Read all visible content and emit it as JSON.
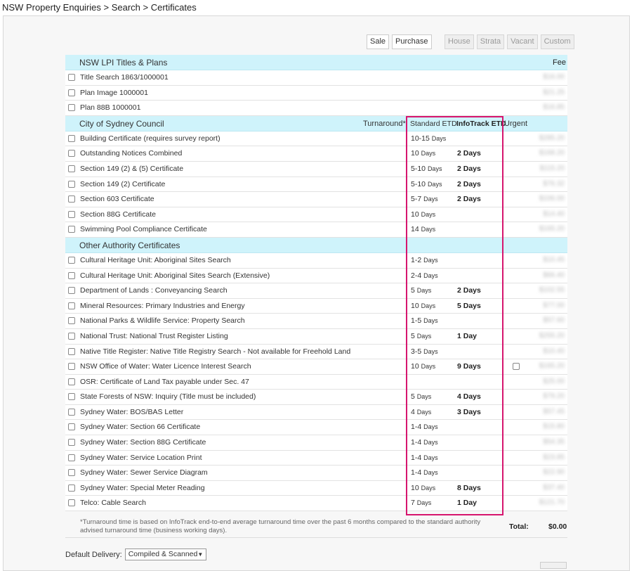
{
  "breadcrumb": "NSW Property Enquiries > Search > Certificates",
  "filters": {
    "group1": [
      "Sale",
      "Purchase"
    ],
    "group2": [
      "House",
      "Strata",
      "Vacant",
      "Custom"
    ]
  },
  "sections": [
    {
      "title": "NSW LPI Titles & Plans",
      "fee_label": "Fee",
      "rows": [
        {
          "name": "Title Search 1863/1000001",
          "std": "",
          "std_unit": "",
          "ifx": "",
          "fee": "$16.00"
        },
        {
          "name": "Plan Image 1000001",
          "std": "",
          "std_unit": "",
          "ifx": "",
          "fee": "$21.25"
        },
        {
          "name": "Plan 88B 1000001",
          "std": "",
          "std_unit": "",
          "ifx": "",
          "fee": "$16.85"
        }
      ]
    },
    {
      "title": "City of Sydney Council",
      "turnaround_label": "Turnaround*",
      "std_label": "Standard ETD",
      "ifx_label": "InfoTrack ETD",
      "urgent_label": "Urgent",
      "rows": [
        {
          "name": "Building Certificate (requires survey report)",
          "std": "10-15",
          "std_unit": "Days",
          "ifx": "",
          "fee": "$285.20"
        },
        {
          "name": "Outstanding Notices Combined",
          "std": "10",
          "std_unit": "Days",
          "ifx": "2 Days",
          "fee": "$168.20"
        },
        {
          "name": "Section 149 (2) & (5) Certificate",
          "std": "5-10",
          "std_unit": "Days",
          "ifx": "2 Days",
          "fee": "$115.20"
        },
        {
          "name": "Section 149 (2) Certificate",
          "std": "5-10",
          "std_unit": "Days",
          "ifx": "2 Days",
          "fee": "$76.32"
        },
        {
          "name": "Section 603 Certificate",
          "std": "5-7",
          "std_unit": "Days",
          "ifx": "2 Days",
          "fee": "$106.00"
        },
        {
          "name": "Section 88G Certificate",
          "std": "10",
          "std_unit": "Days",
          "ifx": "",
          "fee": "$14.40"
        },
        {
          "name": "Swimming Pool Compliance Certificate",
          "std": "14",
          "std_unit": "Days",
          "ifx": "",
          "fee": "$165.20"
        }
      ]
    },
    {
      "title": "Other Authority Certificates",
      "rows": [
        {
          "name": "Cultural Heritage Unit: Aboriginal Sites Search",
          "std": "1-2",
          "std_unit": "Days",
          "ifx": "",
          "fee": "$10.45"
        },
        {
          "name": "Cultural Heritage Unit: Aboriginal Sites Search (Extensive)",
          "std": "2-4",
          "std_unit": "Days",
          "ifx": "",
          "fee": "$66.40"
        },
        {
          "name": "Department of Lands : Conveyancing Search",
          "std": "5",
          "std_unit": "Days",
          "ifx": "2 Days",
          "fee": "$102.55"
        },
        {
          "name": "Mineral Resources: Primary Industries and Energy",
          "std": "10",
          "std_unit": "Days",
          "ifx": "5 Days",
          "fee": "$77.00"
        },
        {
          "name": "National Parks & Wildlife Service: Property Search",
          "std": "1-5",
          "std_unit": "Days",
          "ifx": "",
          "fee": "$57.60"
        },
        {
          "name": "National Trust: National Trust Register Listing",
          "std": "5",
          "std_unit": "Days",
          "ifx": "1 Day",
          "fee": "$255.20"
        },
        {
          "name": "Native Title Register: Native Title Registry Search - Not available for Freehold Land",
          "std": "3-5",
          "std_unit": "Days",
          "ifx": "",
          "fee": "$10.40"
        },
        {
          "name": "NSW Office of Water: Water Licence Interest Search",
          "std": "10",
          "std_unit": "Days",
          "ifx": "9 Days",
          "fee": "$165.20",
          "urgent": true
        },
        {
          "name": "OSR: Certificate of Land Tax payable under Sec. 47",
          "std": "",
          "std_unit": "",
          "ifx": "",
          "fee": "$25.00"
        },
        {
          "name": "State Forests of NSW: Inquiry (Title must be included)",
          "std": "5",
          "std_unit": "Days",
          "ifx": "4 Days",
          "fee": "$79.20"
        },
        {
          "name": "Sydney Water: BOS/BAS Letter",
          "std": "4",
          "std_unit": "Days",
          "ifx": "3 Days",
          "fee": "$57.45"
        },
        {
          "name": "Sydney Water: Section 66 Certificate",
          "std": "1-4",
          "std_unit": "Days",
          "ifx": "",
          "fee": "$15.80"
        },
        {
          "name": "Sydney Water: Section 88G Certificate",
          "std": "1-4",
          "std_unit": "Days",
          "ifx": "",
          "fee": "$54.35"
        },
        {
          "name": "Sydney Water: Service Location Print",
          "std": "1-4",
          "std_unit": "Days",
          "ifx": "",
          "fee": "$23.85"
        },
        {
          "name": "Sydney Water: Sewer Service Diagram",
          "std": "1-4",
          "std_unit": "Days",
          "ifx": "",
          "fee": "$22.90"
        },
        {
          "name": "Sydney Water: Special Meter Reading",
          "std": "10",
          "std_unit": "Days",
          "ifx": "8 Days",
          "fee": "$37.40"
        },
        {
          "name": "Telco: Cable Search",
          "std": "7",
          "std_unit": "Days",
          "ifx": "1 Day",
          "fee": "$121.70"
        }
      ]
    }
  ],
  "footnote": "*Turnaround time is based on InfoTrack end-to-end average turnaround time over the past 6 months compared to the standard authority advised turnaround time (business working days).",
  "total_label": "Total:",
  "total_value": "$0.00",
  "delivery": {
    "label": "Default Delivery:",
    "selected": "Compiled & Scanned",
    "arrow": "▼"
  },
  "colors": {
    "header_bg": "#cff3fb",
    "highlight": "#d6156e"
  }
}
